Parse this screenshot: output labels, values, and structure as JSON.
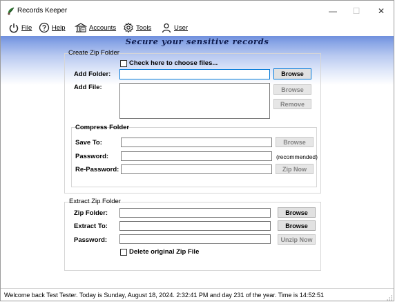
{
  "window": {
    "title": "Records Keeper",
    "minimize": "—",
    "maximize": "☐",
    "close": "✕"
  },
  "menu": {
    "file": "File",
    "help": "Help",
    "accounts": "Accounts",
    "tools": "Tools",
    "user": "User"
  },
  "banner": {
    "slogan": "Secure your sensitive records"
  },
  "create": {
    "legend": "Create Zip Folder",
    "choose_files_label": "Check here to choose files...",
    "add_folder_label": "Add Folder:",
    "add_folder_value": "",
    "add_file_label": "Add File:",
    "browse_folder": "Browse",
    "browse_file": "Browse",
    "remove": "Remove",
    "compress": {
      "legend": "Compress Folder",
      "save_to_label": "Save To:",
      "save_to_value": "",
      "password_label": "Password:",
      "password_value": "",
      "repassword_label": "Re-Password:",
      "repassword_value": "",
      "browse": "Browse",
      "recommended": "(recommended)",
      "zip_now": "Zip Now"
    }
  },
  "extract": {
    "legend": "Extract Zip Folder",
    "zip_folder_label": "Zip Folder:",
    "zip_folder_value": "",
    "extract_to_label": "Extract To:",
    "extract_to_value": "",
    "password_label": "Password:",
    "password_value": "",
    "browse_zip": "Browse",
    "browse_extract": "Browse",
    "unzip_now": "Unzip Now",
    "delete_label": "Delete original Zip File"
  },
  "status": {
    "text": "Welcome back Test Tester.   Today is Sunday, August 18, 2024. 2:32:41 PM and day 231 of the year.   Time is 14:52:51"
  }
}
